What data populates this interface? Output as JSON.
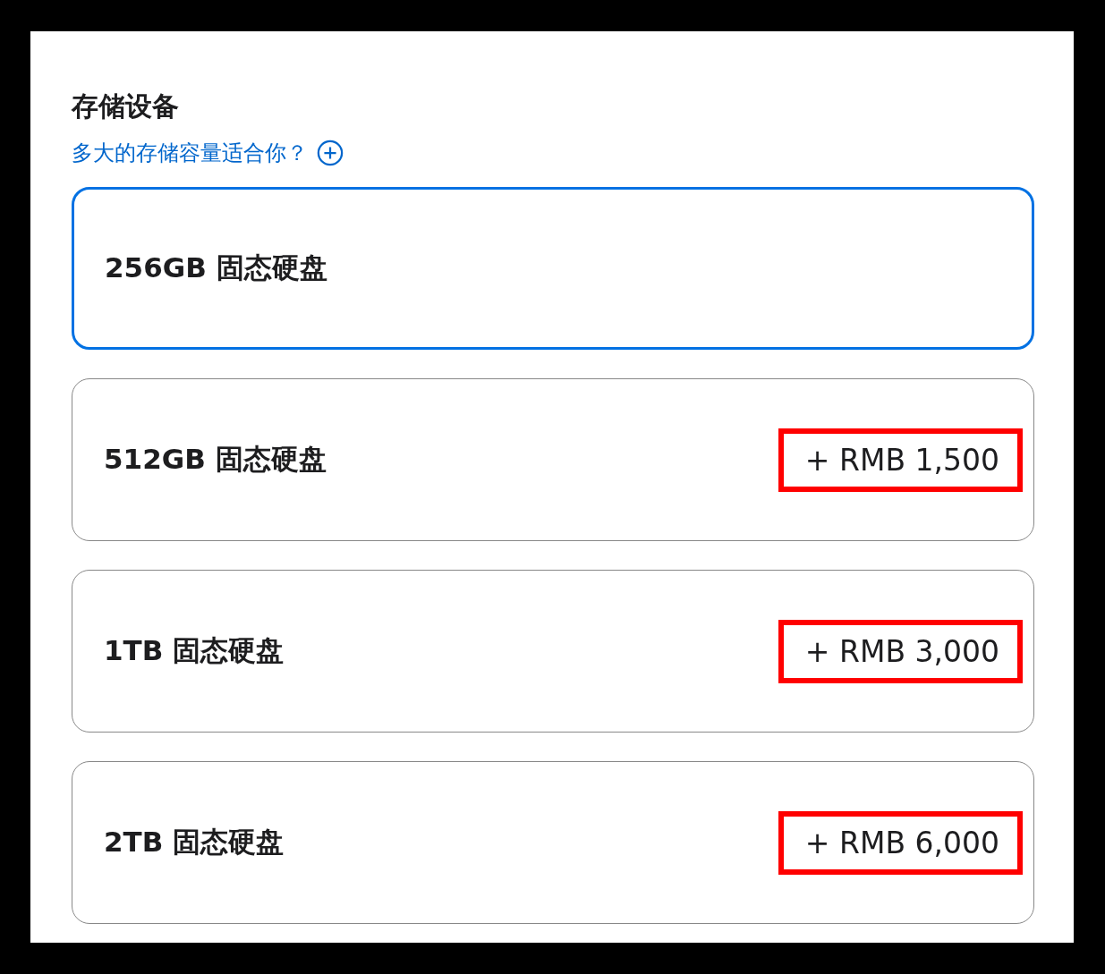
{
  "section": {
    "title": "存储设备",
    "help_link": "多大的存储容量适合你？"
  },
  "options": [
    {
      "label": "256GB 固态硬盘",
      "selected": true
    },
    {
      "label": "512GB 固态硬盘",
      "price": "+ RMB 1,500",
      "selected": false,
      "highlighted": true
    },
    {
      "label": "1TB 固态硬盘",
      "price": "+ RMB 3,000",
      "selected": false,
      "highlighted": true
    },
    {
      "label": "2TB 固态硬盘",
      "price": "+ RMB 6,000",
      "selected": false,
      "highlighted": true
    }
  ]
}
